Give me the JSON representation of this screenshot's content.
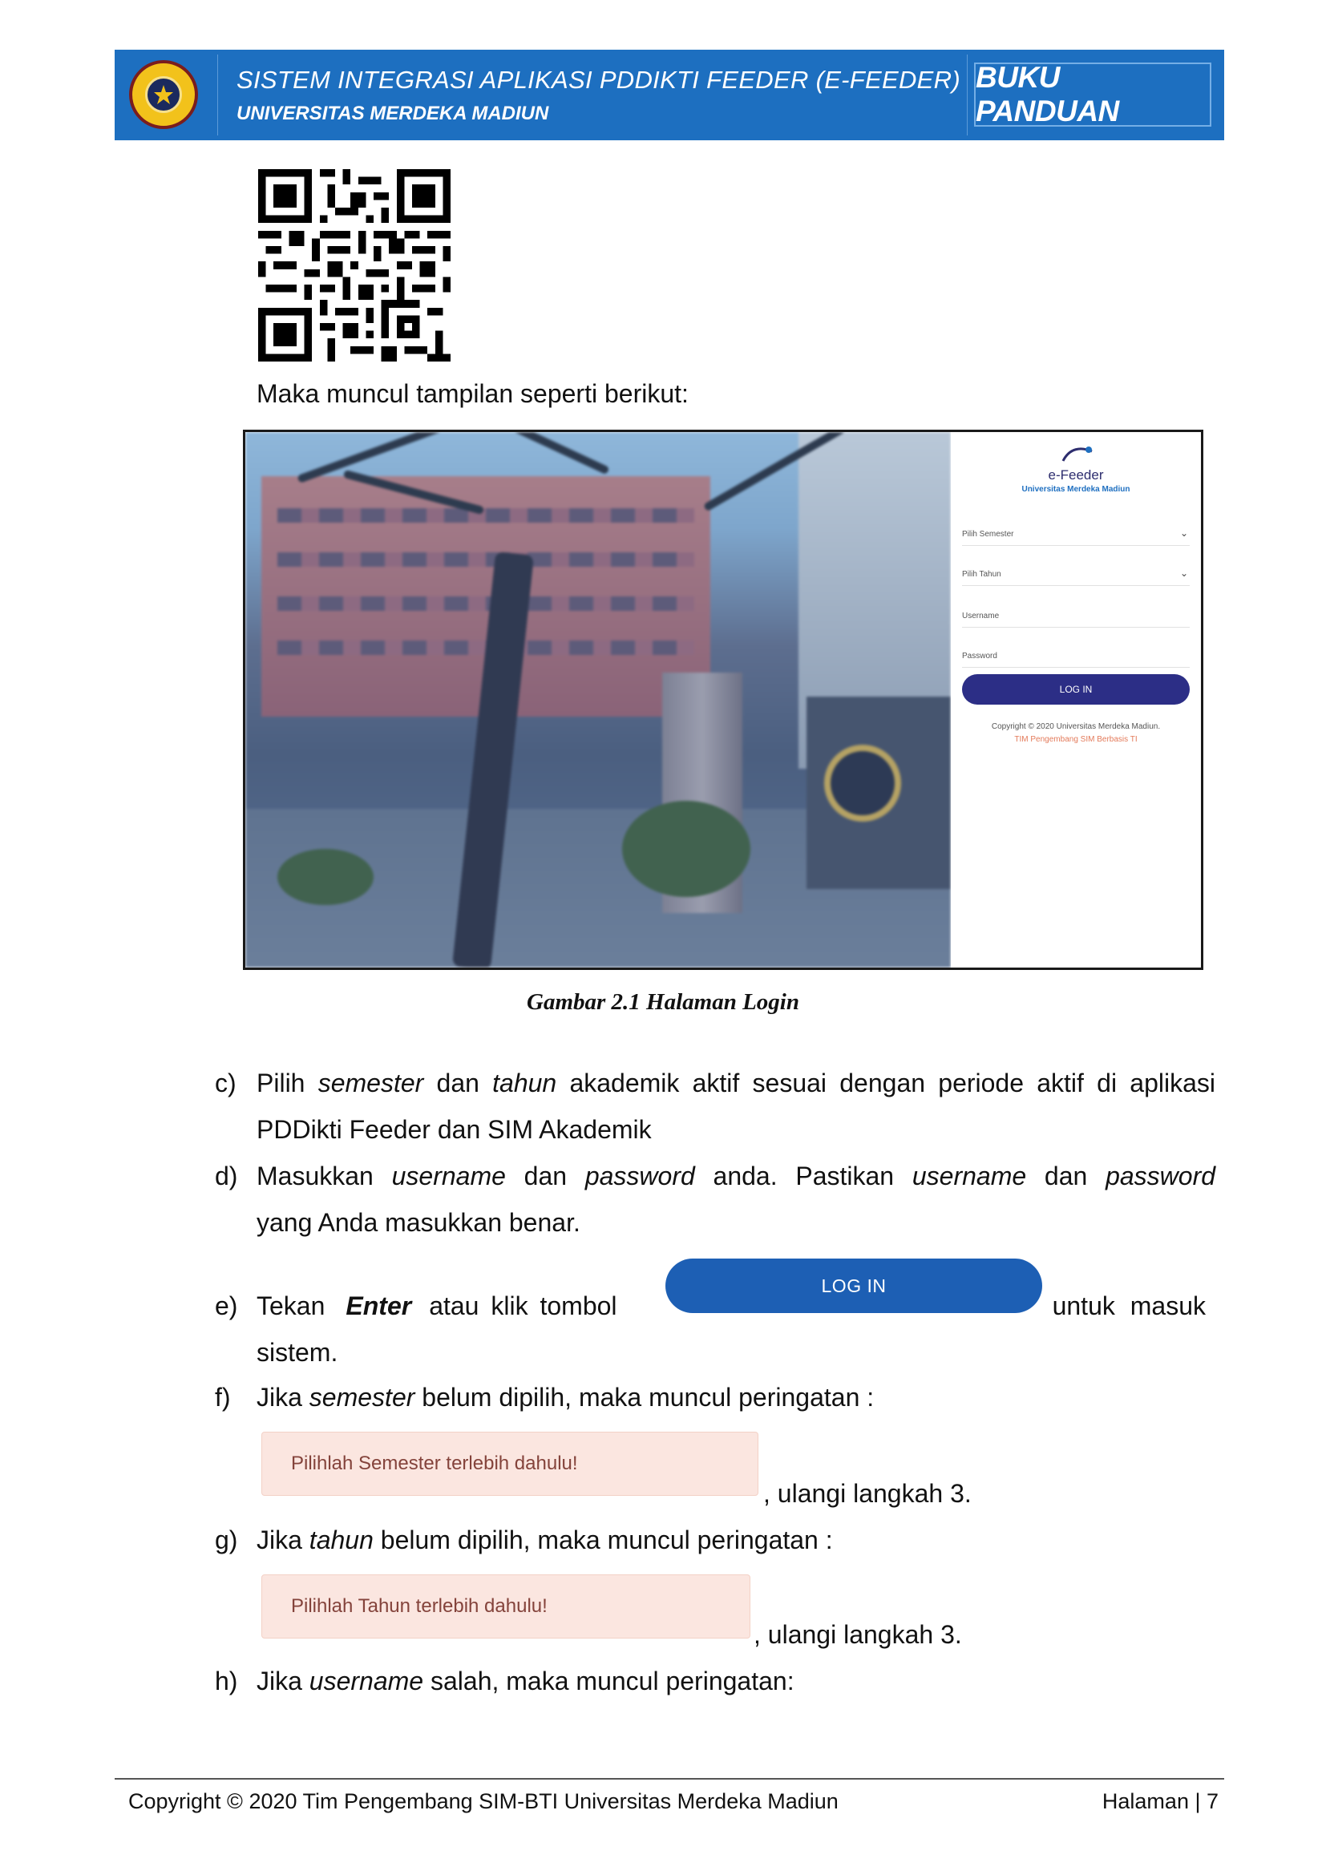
{
  "header": {
    "title": "SISTEM INTEGRASI APLIKASI PDDIKTI FEEDER (E-FEEDER)",
    "subtitle": "UNIVERSITAS MERDEKA MADIUN",
    "badge": "BUKU PANDUAN",
    "logo_text": "UNIVERSITAS MERDEKA MADIUN"
  },
  "intro": "Maka muncul tampilan seperti berikut:",
  "login_screen": {
    "app_name": "e-Feeder",
    "university": "Universitas Merdeka Madiun",
    "semester_placeholder": "Pilih Semester",
    "year_placeholder": "Pilih Tahun",
    "username_placeholder": "Username",
    "password_placeholder": "Password",
    "login_label": "LOG IN",
    "copyright": "Copyright © 2020 Universitas Merdeka Madiun.",
    "team": "TIM Pengembang SIM Berbasis TI"
  },
  "caption": "Gambar 2.1 Halaman Login",
  "steps": {
    "c": {
      "marker": "c)",
      "p1": "Pilih ",
      "p1_em": "semester",
      "p2": " dan ",
      "p2_em": "tahun",
      "p3": " akademik aktif sesuai dengan periode aktif di aplikasi",
      "line2": "PDDikti Feeder dan SIM Akademik"
    },
    "d": {
      "marker": "d)",
      "p1": "Masukkan ",
      "p1_em": "username",
      "p2": " dan ",
      "p2_em": "password",
      "p3": " anda. Pastikan ",
      "p3_em": "username",
      "p4": " dan ",
      "p4_em": "password",
      "line2": "yang Anda masukkan benar."
    },
    "e": {
      "marker": "e)",
      "p1": "Tekan",
      "p1_strong": "Enter",
      "p2": "atau  klik  tombol",
      "button": "LOG IN",
      "p3": "untuk  masuk",
      "line2": "sistem."
    },
    "f": {
      "marker": "f)",
      "p1": "Jika ",
      "p1_em": "semester",
      "p2": " belum dipilih, maka muncul peringatan :",
      "alert": "Pilihlah Semester terlebih dahulu!",
      "after": ", ulangi langkah 3."
    },
    "g": {
      "marker": "g)",
      "p1": "Jika ",
      "p1_em": "tahun",
      "p2": " belum dipilih, maka muncul peringatan :",
      "alert": "Pilihlah Tahun terlebih dahulu!",
      "after": ", ulangi langkah 3."
    },
    "h": {
      "marker": "h)",
      "p1": "Jika ",
      "p1_em": "username",
      "p2": " salah, maka muncul peringatan:"
    }
  },
  "footer": {
    "copyright": "Copyright © 2020 Tim Pengembang SIM-BTI Universitas Merdeka Madiun",
    "page": "Halaman  |  7"
  },
  "colors": {
    "header_blue": "#1d6fc0",
    "button_blue": "#1d5fb4",
    "login_navy": "#2c2e86",
    "alert_bg": "#fbe6e0",
    "alert_text": "#84433b"
  }
}
